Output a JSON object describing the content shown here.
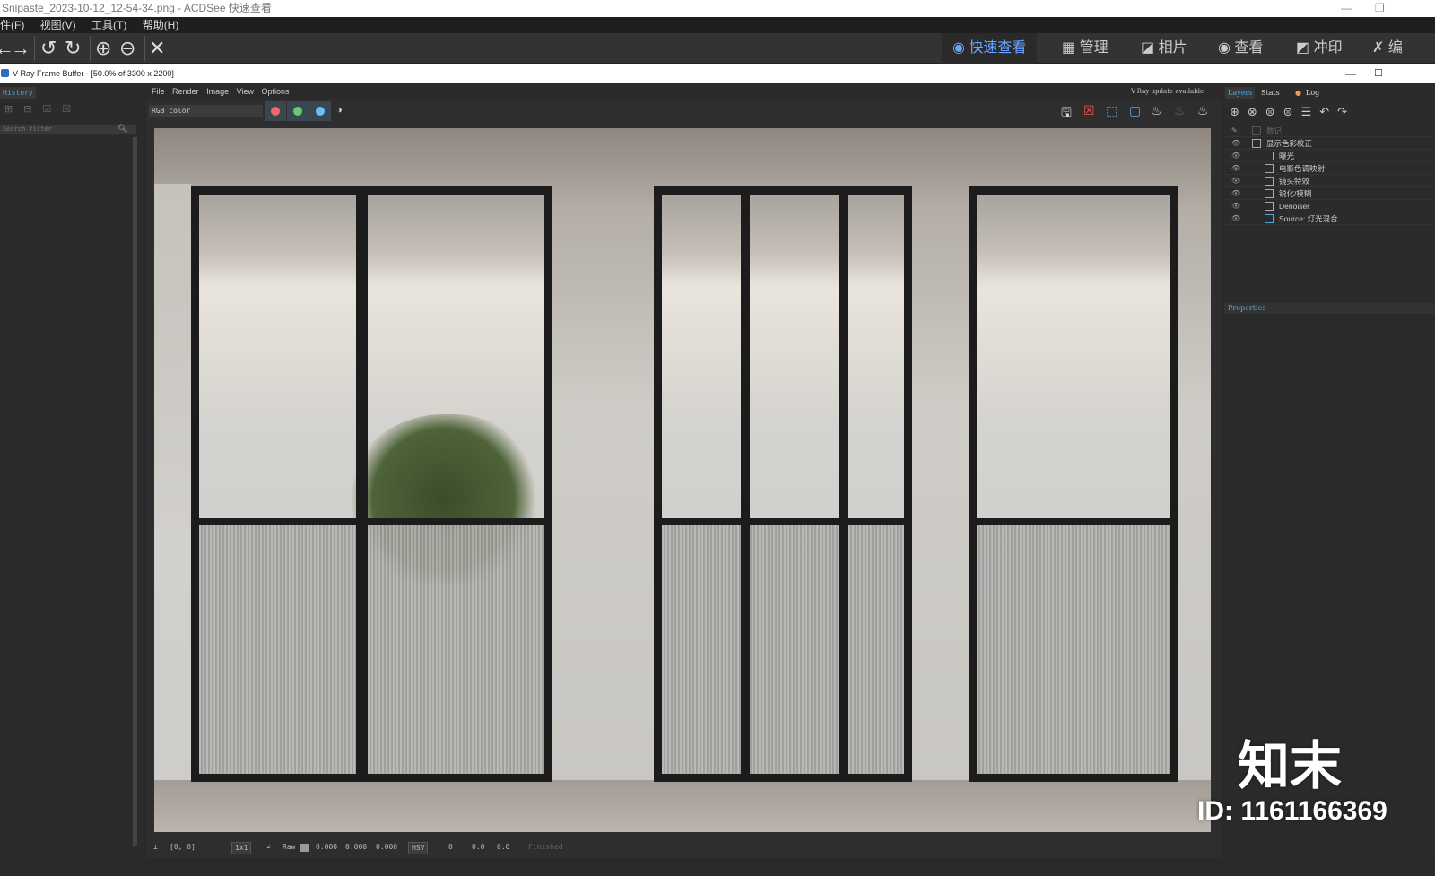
{
  "window": {
    "title": "Snipaste_2023-10-12_12-54-34.png - ACDSee 快速查看",
    "minimize": "—",
    "restore": "❐"
  },
  "menu": [
    "件(F)",
    "视图(V)",
    "工具(T)",
    "帮助(H)"
  ],
  "toolbar": {
    "back": "←",
    "forward": "→",
    "rotate_left": "↺",
    "rotate_right": "↻",
    "zoom_in": "⊕",
    "zoom_out": "⊖",
    "close": "✕"
  },
  "modes": [
    {
      "label": "快速查看",
      "icon": "eye-bolt-icon",
      "active": true
    },
    {
      "label": "管理",
      "icon": "grid-icon"
    },
    {
      "label": "相片",
      "icon": "photos-icon"
    },
    {
      "label": "查看",
      "icon": "eye-icon"
    },
    {
      "label": "冲印",
      "icon": "develop-icon"
    },
    {
      "label": "编",
      "icon": "tools-icon"
    }
  ],
  "vfb": {
    "title": "V-Ray Frame Buffer - [50.0% of 3300 x 2200]",
    "menu": [
      "File",
      "Render",
      "Image",
      "View",
      "Options"
    ],
    "update": "V-Ray update available!",
    "channel": "RGB color",
    "colors": {
      "red": "#f06a6a",
      "green": "#5fd06a",
      "blue": "#62c3f5",
      "accent": "#4fa8e0"
    }
  },
  "history": {
    "tab": "History",
    "search_placeholder": "Search filter"
  },
  "right": {
    "tabs": [
      "Layers",
      "Stats",
      "Log"
    ],
    "layers": [
      {
        "name": "数记",
        "dim": true
      },
      {
        "name": "显示色彩校正"
      },
      {
        "name": "曝光"
      },
      {
        "name": "电影色调映射"
      },
      {
        "name": "镜头特效"
      },
      {
        "name": "锐化/模糊"
      },
      {
        "name": "Denoiser"
      },
      {
        "name": "Source: 灯光混合"
      }
    ],
    "properties": "Properties"
  },
  "status": {
    "coords": "[0, 0]",
    "sample": "1x1",
    "raw": "Raw",
    "r": "0.000",
    "g": "0.000",
    "b": "0.000",
    "mode": "HSV",
    "h": "0",
    "s": "0.0",
    "v": "0.0",
    "state": "Finished"
  },
  "watermark": {
    "logo": "知末",
    "id": "ID: 1161166369"
  }
}
